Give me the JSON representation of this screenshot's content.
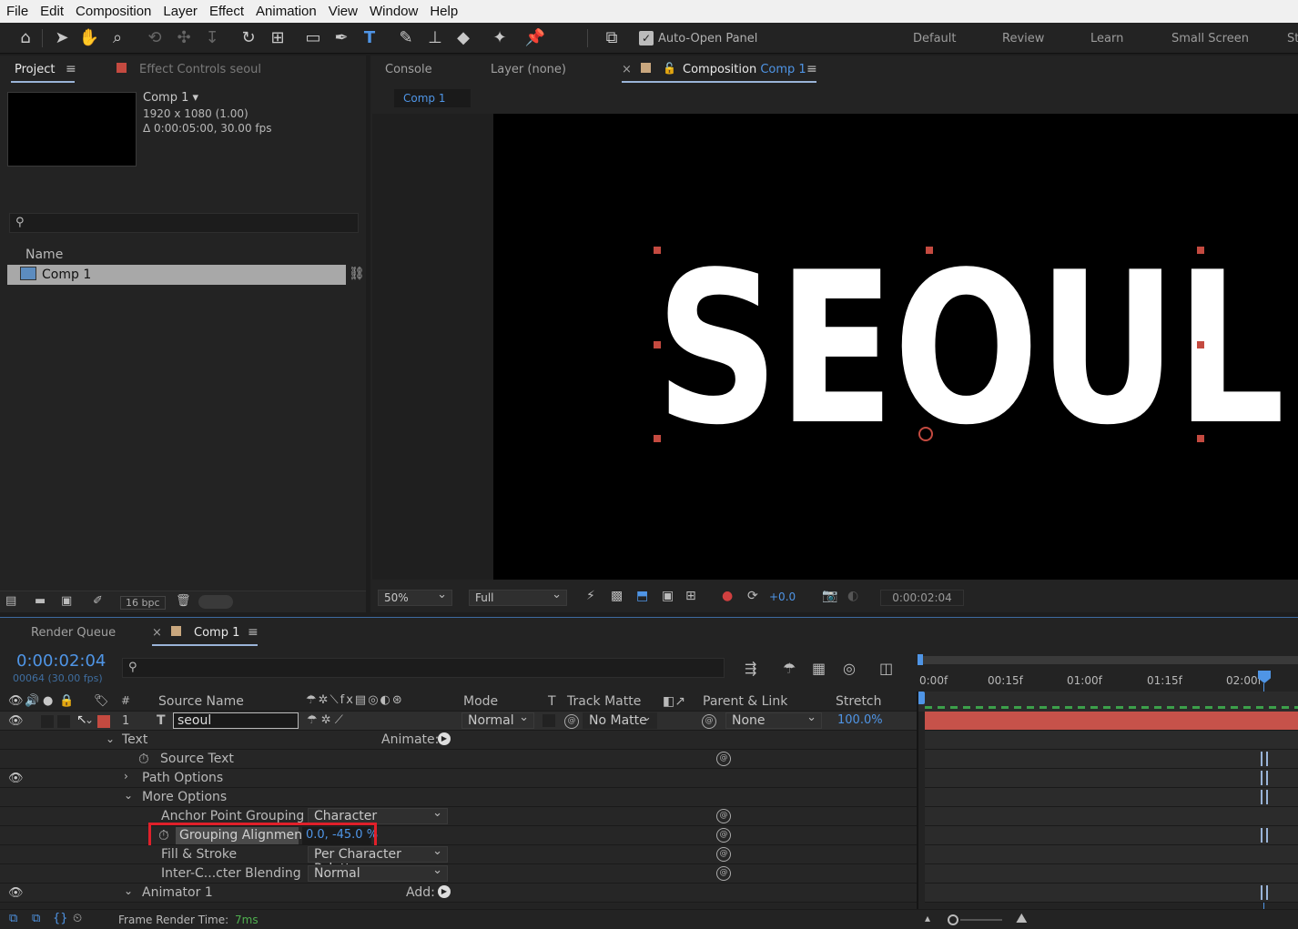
{
  "menu": [
    "File",
    "Edit",
    "Composition",
    "Layer",
    "Effect",
    "Animation",
    "View",
    "Window",
    "Help"
  ],
  "toolbar": {
    "auto_open": "Auto-Open Panel",
    "workspaces": [
      "Default",
      "Review",
      "Learn",
      "Small Screen",
      "St"
    ]
  },
  "project": {
    "tab": "Project",
    "effect_controls": "Effect Controls seoul",
    "comp_name": "Comp 1",
    "comp_res": "1920 x 1080 (1.00)",
    "comp_dur": "Δ 0:00:05:00, 30.00 fps",
    "col_name": "Name",
    "item": "Comp 1",
    "bpc": "16 bpc"
  },
  "viewer": {
    "tabs": [
      "Console",
      "Layer (none)"
    ],
    "comp_tab": "Composition",
    "comp_tab_name": "Comp 1",
    "sub_tab": "Comp 1",
    "text": "SEOUL",
    "zoom": "50%",
    "quality": "Full",
    "exposure": "+0.0",
    "time": "0:00:02:04"
  },
  "timeline": {
    "tabs": [
      "Render Queue",
      "Comp 1"
    ],
    "timecode": "0:00:02:04",
    "frames": "00064 (30.00 fps)",
    "ruler": [
      "0:00f",
      "00:15f",
      "01:00f",
      "01:15f",
      "02:00f"
    ],
    "cols": {
      "num": "#",
      "source": "Source Name",
      "mode": "Mode",
      "t": "T",
      "matte": "Track Matte",
      "parent": "Parent & Link",
      "stretch": "Stretch"
    },
    "layer": {
      "num": "1",
      "name": "seoul",
      "mode": "Normal",
      "matte": "No Matte",
      "parent": "None",
      "stretch": "100.0%"
    },
    "props": {
      "text": "Text",
      "animate": "Animate:",
      "source_text": "Source Text",
      "path_options": "Path Options",
      "more_options": "More Options",
      "anchor_grouping": "Anchor Point Grouping",
      "anchor_grouping_val": "Character",
      "grouping_alignment": "Grouping Alignment",
      "grouping_alignment_val": "0.0, -45.0 %",
      "fill_stroke": "Fill & Stroke",
      "fill_stroke_val": "Per Character Palette",
      "blending": "Inter-C...cter Blending",
      "blending_val": "Normal",
      "animator": "Animator 1",
      "add": "Add:"
    },
    "render_time_label": "Frame Render Time:",
    "render_time": "7ms"
  },
  "colors": {
    "accent": "#4f95e6",
    "highlight": "#e0202a",
    "label_red": "#c44a40",
    "bar": "#c6524a"
  }
}
